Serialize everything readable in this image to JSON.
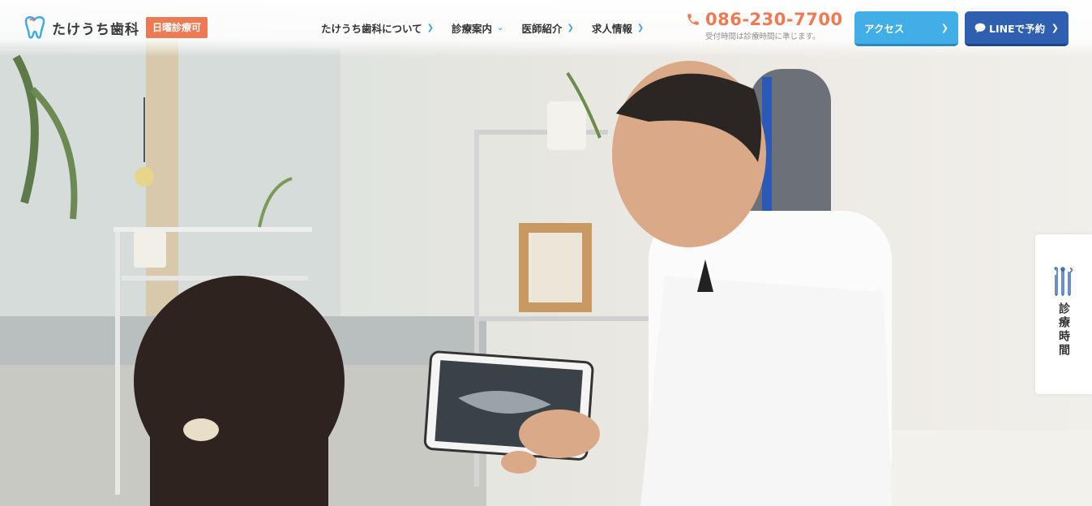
{
  "brand": {
    "name": "たけうち歯科",
    "badge": "日曜診療可"
  },
  "nav": {
    "items": [
      {
        "label": "たけうち歯科について",
        "icon": "chevron-right-icon"
      },
      {
        "label": "診療案内",
        "icon": "chevron-down-icon"
      },
      {
        "label": "医師紹介",
        "icon": "chevron-right-icon"
      },
      {
        "label": "求人情報",
        "icon": "chevron-right-icon"
      }
    ]
  },
  "contact": {
    "phone": "086-230-7700",
    "note": "受付時間は診療時間に準じます。"
  },
  "buttons": {
    "access": "アクセス",
    "line": "LINEで予約"
  },
  "side_tab": {
    "label": "診療時間"
  },
  "colors": {
    "accent_orange": "#ee7a53",
    "access_blue": "#41aee7",
    "line_blue": "#2e5fb0",
    "chevron_blue": "#3ba8df"
  }
}
